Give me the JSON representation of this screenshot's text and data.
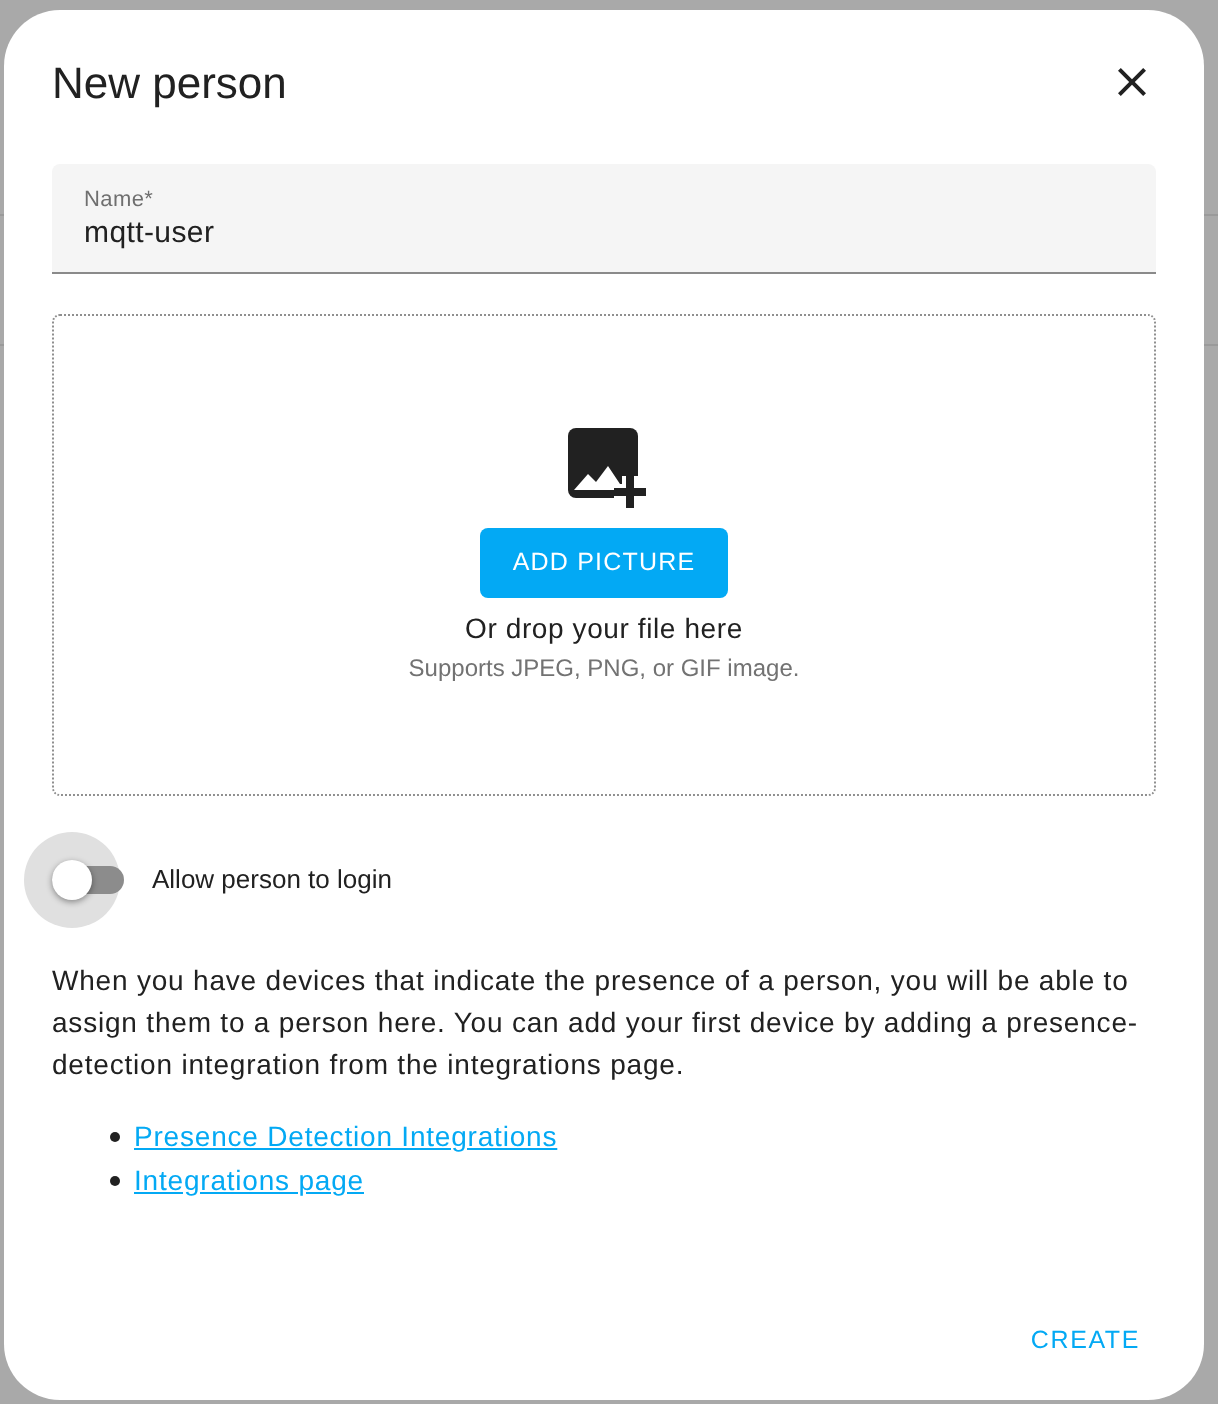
{
  "dialog": {
    "title": "New person"
  },
  "name_field": {
    "label": "Name*",
    "value": "mqtt-user"
  },
  "picture_upload": {
    "button": "ADD PICTURE",
    "hint": "Or drop your file here",
    "formats": "Supports JPEG, PNG, or GIF image."
  },
  "login_toggle": {
    "label": "Allow person to login",
    "on": false
  },
  "description": "When you have devices that indicate the presence of a person, you will be able to assign them to a person here. You can add your first device by adding a presence-detection integration from the integrations page.",
  "links": [
    {
      "label": "Presence Detection Integrations"
    },
    {
      "label": "Integrations page"
    }
  ],
  "actions": [
    {
      "label": "CREATE"
    }
  ]
}
